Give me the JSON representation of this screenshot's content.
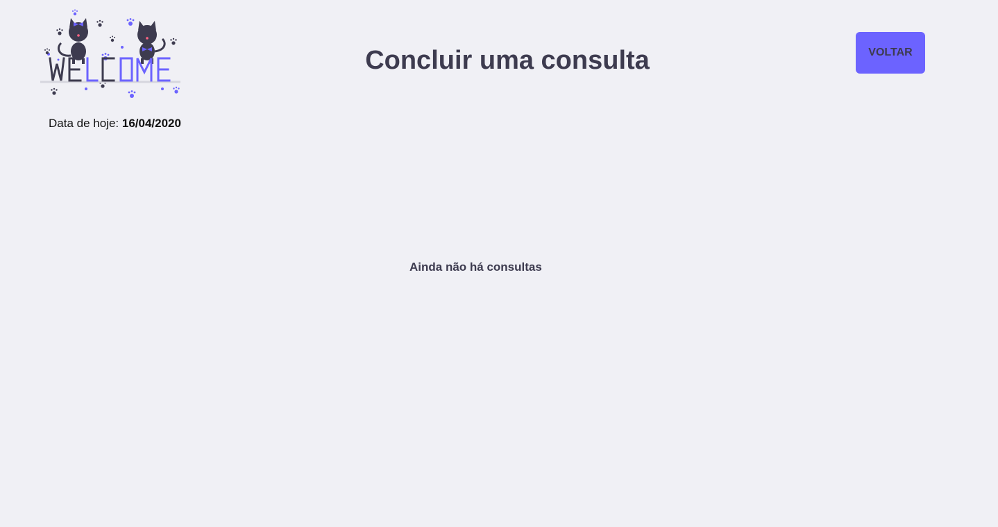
{
  "header": {
    "title": "Concluir uma consulta",
    "back_button_label": "VOLTAR",
    "logo_text": "WELCOME",
    "logo_icon": "welcome-cats-illustration"
  },
  "date": {
    "label": "Data de hoje:",
    "value": "16/04/2020"
  },
  "main": {
    "empty_message": "Ainda não há consultas"
  },
  "colors": {
    "background": "#f0f0f5",
    "accent": "#6c63ff",
    "text": "#3d3b4f"
  }
}
